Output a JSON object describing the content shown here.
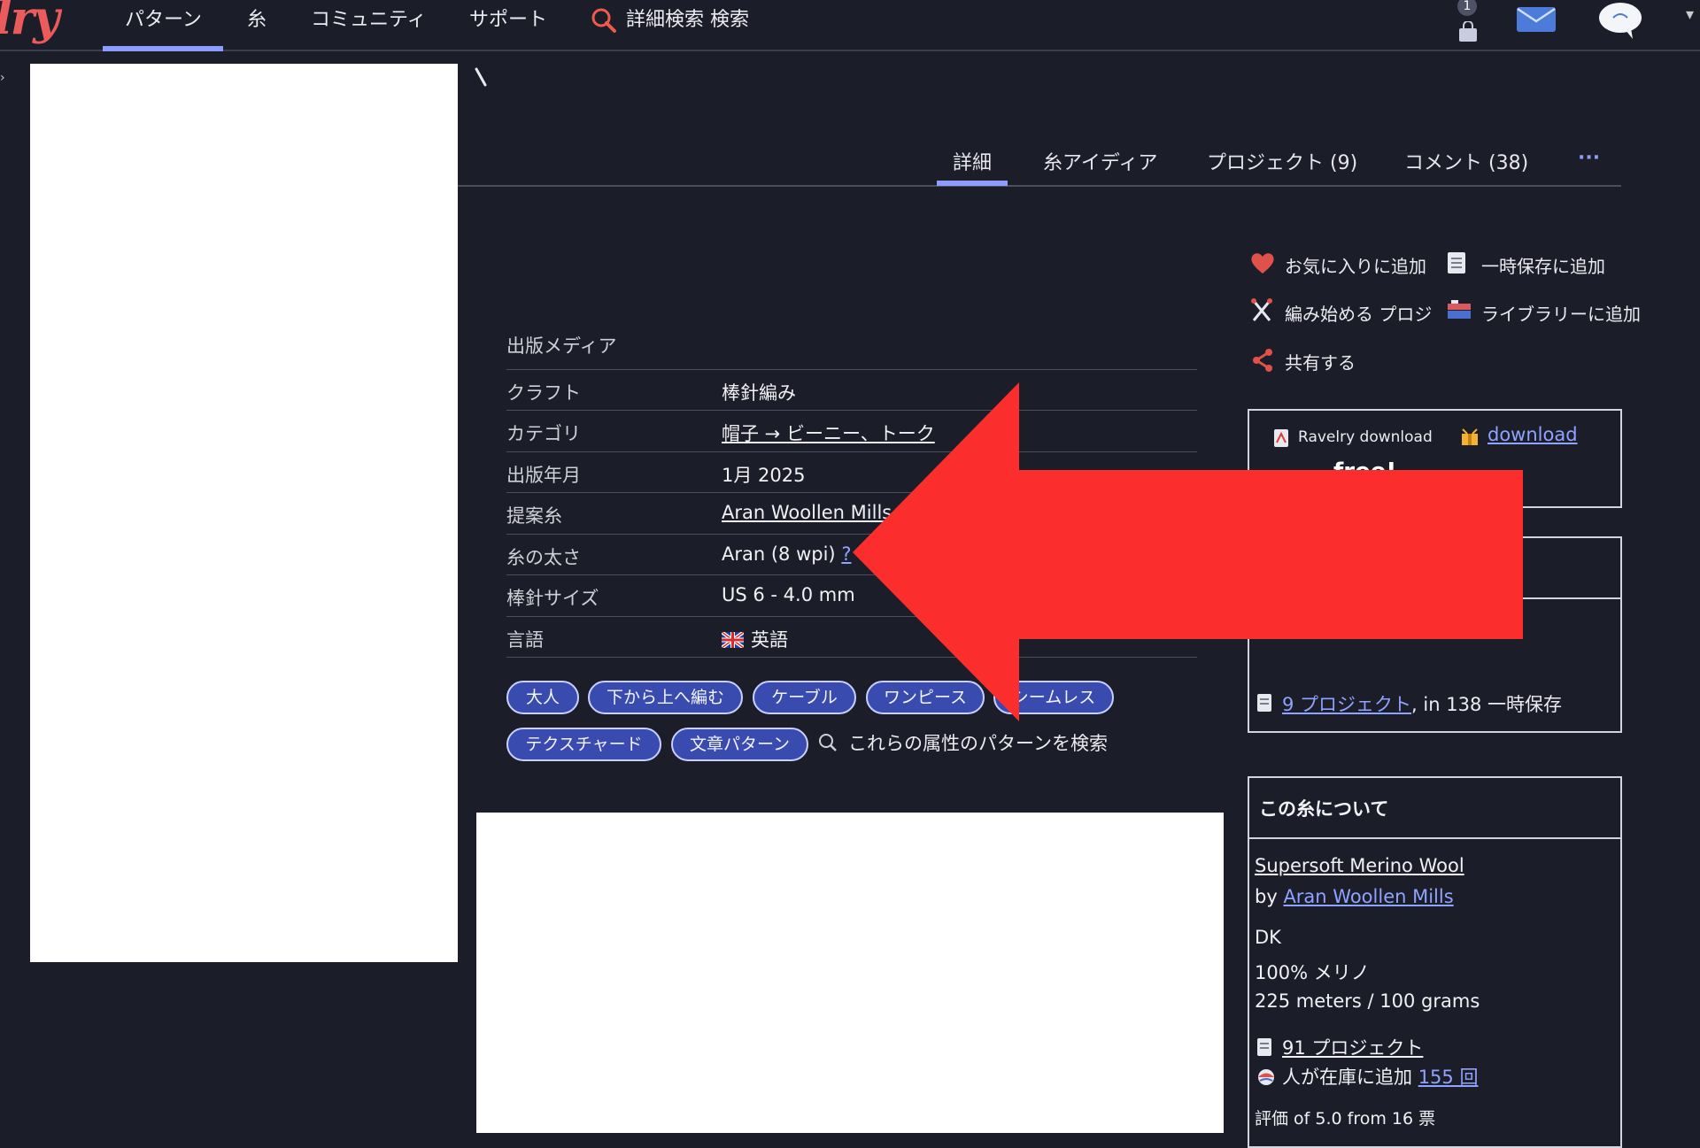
{
  "nav": {
    "logo": "lry",
    "items": [
      "パターン",
      "糸",
      "コミュニティ",
      "サポート"
    ],
    "search_label": "詳細検索 検索",
    "cart_count": "1"
  },
  "tabs": [
    {
      "label": "詳細"
    },
    {
      "label": "糸アイディア"
    },
    {
      "label": "プロジェクト (9)"
    },
    {
      "label": "コメント (38)"
    },
    {
      "label": "···"
    }
  ],
  "details": {
    "rows": [
      {
        "label": "出版メディア",
        "value": ""
      },
      {
        "label": "クラフト",
        "value": "棒針編み"
      },
      {
        "label": "カテゴリ",
        "value": "帽子 → ビーニー、トーク"
      },
      {
        "label": "出版年月",
        "value": "1月 2025"
      },
      {
        "label": "提案糸",
        "value": "Aran Woollen Mills"
      },
      {
        "label": "糸の太さ",
        "value": "Aran (8 wpi)",
        "help": "?"
      },
      {
        "label": "棒針サイズ",
        "value": "US 6 - 4.0 mm"
      },
      {
        "label": "言語",
        "value": "英語"
      }
    ]
  },
  "tags": [
    "大人",
    "下から上へ編む",
    "ケーブル",
    "ワンピース",
    "シームレス",
    "テクスチャード",
    "文章パターン"
  ],
  "tag_search_label": "これらの属性のパターンを検索",
  "actions": {
    "favorite": "お気に入りに追加",
    "queue": "一時保存に追加",
    "start_project": "編み始める プロジ",
    "library": "ライブラリーに追加",
    "share": "共有する"
  },
  "download_box": {
    "ravelry_download": "Ravelry download",
    "download_link": "download",
    "price": "free!"
  },
  "projects_box": {
    "projects_link": "9 プロジェクト",
    "queued_text": ", in 138 一時保存"
  },
  "yarn_box": {
    "heading": "この糸について",
    "yarn_name": "Supersoft Merino Wool",
    "by": "by ",
    "brand": "Aran Woollen Mills",
    "weight": "DK",
    "fiber": "100% メリノ",
    "yardage": "225 meters / 100 grams",
    "projects_link": "91 プロジェクト",
    "stash_text": "人が在庫に追加 ",
    "stash_link": "155 回",
    "rating": "評価 of 5.0 from 16 票"
  },
  "colors": {
    "background": "#1b1d29",
    "accent": "#8f9cff",
    "tag_fill": "#3a4bb0",
    "link": "#8fa3ff",
    "annotation_arrow": "#fb2d2d"
  }
}
